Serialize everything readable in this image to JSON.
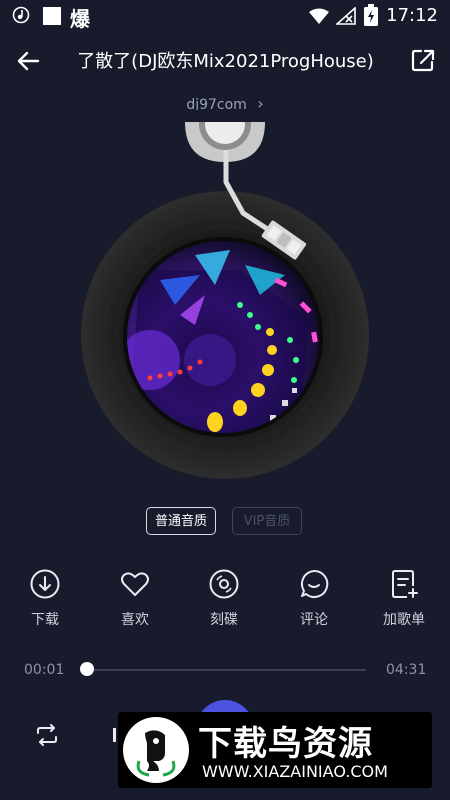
{
  "status_bar": {
    "left_text": "爆",
    "time": "17:12"
  },
  "header": {
    "title": "了散了(DJ欧东Mix2021ProgHouse)",
    "back_icon": "arrow-left-icon",
    "share_icon": "share-icon"
  },
  "artist": {
    "name": "dj97com",
    "chevron": "›"
  },
  "quality": {
    "normal_label": "普通音质",
    "vip_label": "VIP音质"
  },
  "actions": [
    {
      "label": "下载",
      "icon": "download-icon"
    },
    {
      "label": "喜欢",
      "icon": "heart-icon"
    },
    {
      "label": "刻碟",
      "icon": "disc-icon"
    },
    {
      "label": "评论",
      "icon": "comment-icon"
    },
    {
      "label": "加歌单",
      "icon": "add-to-playlist-icon"
    }
  ],
  "progress": {
    "elapsed": "00:01",
    "duration": "04:31",
    "fraction": 0.004
  },
  "watermark": {
    "title": "下载鸟资源",
    "url": "WWW.XIAZAINIAO.COM"
  },
  "colors": {
    "background": "#171b2b",
    "accent": "#4d52e0"
  }
}
